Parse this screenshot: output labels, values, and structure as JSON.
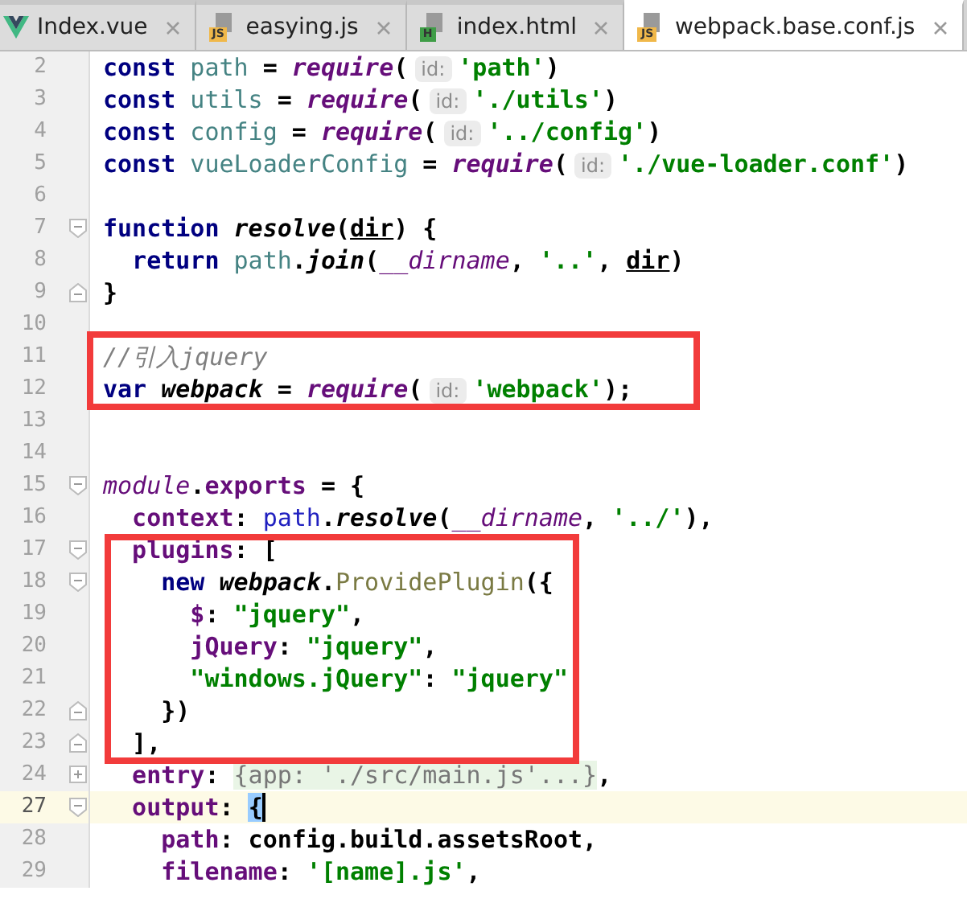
{
  "tabs": [
    {
      "label": "Index.vue",
      "kind": "vue",
      "selected": false
    },
    {
      "label": "easying.js",
      "kind": "js",
      "icon_label": "JS",
      "selected": false
    },
    {
      "label": "index.html",
      "kind": "html",
      "icon_label": "H",
      "selected": false
    },
    {
      "label": "webpack.base.conf.js",
      "kind": "js",
      "icon_label": "JS",
      "selected": true
    }
  ],
  "lines": [
    {
      "number": "2",
      "tokens": [
        {
          "kind": "kw",
          "text": "const"
        },
        {
          "kind": "var",
          "text": " path"
        },
        {
          "kind": "plain",
          "text": " = "
        },
        {
          "kind": "call",
          "text": "require"
        },
        {
          "kind": "plain",
          "text": "("
        },
        {
          "kind": "hint",
          "text": "id:"
        },
        {
          "kind": "str",
          "text": "'path'"
        },
        {
          "kind": "plain",
          "text": ")"
        }
      ]
    },
    {
      "number": "3",
      "tokens": [
        {
          "kind": "kw",
          "text": "const"
        },
        {
          "kind": "var",
          "text": " utils"
        },
        {
          "kind": "plain",
          "text": " = "
        },
        {
          "kind": "call",
          "text": "require"
        },
        {
          "kind": "plain",
          "text": "("
        },
        {
          "kind": "hint",
          "text": "id:"
        },
        {
          "kind": "str",
          "text": "'./utils'"
        },
        {
          "kind": "plain",
          "text": ")"
        }
      ]
    },
    {
      "number": "4",
      "tokens": [
        {
          "kind": "kw",
          "text": "const"
        },
        {
          "kind": "var",
          "text": " config"
        },
        {
          "kind": "plain",
          "text": " = "
        },
        {
          "kind": "call",
          "text": "require"
        },
        {
          "kind": "plain",
          "text": "("
        },
        {
          "kind": "hint",
          "text": "id:"
        },
        {
          "kind": "str",
          "text": "'../config'"
        },
        {
          "kind": "plain",
          "text": ")"
        }
      ]
    },
    {
      "number": "5",
      "tokens": [
        {
          "kind": "kw",
          "text": "const"
        },
        {
          "kind": "var",
          "text": " vueLoaderConfig"
        },
        {
          "kind": "plain",
          "text": " = "
        },
        {
          "kind": "call",
          "text": "require"
        },
        {
          "kind": "plain",
          "text": "("
        },
        {
          "kind": "hint",
          "text": "id:"
        },
        {
          "kind": "str",
          "text": "'./vue-loader.conf'"
        },
        {
          "kind": "plain",
          "text": ")"
        }
      ]
    },
    {
      "number": "6"
    },
    {
      "number": "7",
      "fold": {
        "kind": "open"
      },
      "tokens": [
        {
          "kind": "kw",
          "text": "function"
        },
        {
          "kind": "italic",
          "text": " resolve"
        },
        {
          "kind": "plain",
          "text": "("
        },
        {
          "kind": "param",
          "text": "dir"
        },
        {
          "kind": "plain",
          "text": ") {"
        }
      ]
    },
    {
      "number": "8",
      "tokens": [
        {
          "kind": "kw",
          "text": "  return"
        },
        {
          "kind": "var",
          "text": " path"
        },
        {
          "kind": "plain",
          "text": "."
        },
        {
          "kind": "italic",
          "text": "join"
        },
        {
          "kind": "plain",
          "text": "("
        },
        {
          "kind": "global",
          "text": "__dirname"
        },
        {
          "kind": "plain",
          "text": ", "
        },
        {
          "kind": "str",
          "text": "'..'"
        },
        {
          "kind": "plain",
          "text": ", "
        },
        {
          "kind": "param",
          "text": "dir"
        },
        {
          "kind": "plain",
          "text": ")"
        }
      ]
    },
    {
      "number": "9",
      "fold": {
        "kind": "close"
      },
      "tokens": [
        {
          "kind": "plain",
          "text": "}"
        }
      ]
    },
    {
      "number": "10"
    },
    {
      "number": "11",
      "boxed": true,
      "tokens": [
        {
          "kind": "comment",
          "text": "//引入jquery"
        }
      ]
    },
    {
      "number": "12",
      "boxed": true,
      "tokens": [
        {
          "kind": "kw",
          "text": "var"
        },
        {
          "kind": "italic",
          "text": " webpack"
        },
        {
          "kind": "plain",
          "text": " = "
        },
        {
          "kind": "call",
          "text": "require"
        },
        {
          "kind": "plain",
          "text": "("
        },
        {
          "kind": "hint",
          "text": "id:"
        },
        {
          "kind": "str",
          "text": "'webpack'"
        },
        {
          "kind": "plain",
          "text": ");"
        }
      ]
    },
    {
      "number": "13"
    },
    {
      "number": "14"
    },
    {
      "number": "15",
      "fold": {
        "kind": "open"
      },
      "tokens": [
        {
          "kind": "global",
          "text": "module"
        },
        {
          "kind": "plain",
          "text": "."
        },
        {
          "kind": "prop",
          "text": "exports"
        },
        {
          "kind": "plain",
          "text": " = {"
        }
      ]
    },
    {
      "number": "16",
      "tokens": [
        {
          "kind": "prop",
          "text": "  context"
        },
        {
          "kind": "plain",
          "text": ": "
        },
        {
          "kind": "ref",
          "text": "path"
        },
        {
          "kind": "plain",
          "text": "."
        },
        {
          "kind": "italic",
          "text": "resolve"
        },
        {
          "kind": "plain",
          "text": "("
        },
        {
          "kind": "global",
          "text": "__dirname"
        },
        {
          "kind": "plain",
          "text": ", "
        },
        {
          "kind": "str",
          "text": "'../'"
        },
        {
          "kind": "plain",
          "text": "),"
        }
      ]
    },
    {
      "number": "17",
      "fold": {
        "kind": "open"
      },
      "boxed": true,
      "tokens": [
        {
          "kind": "prop",
          "text": "  plugins"
        },
        {
          "kind": "plain",
          "text": ": ["
        }
      ]
    },
    {
      "number": "18",
      "fold": {
        "kind": "open"
      },
      "boxed": true,
      "tokens": [
        {
          "kind": "kw",
          "text": "    new"
        },
        {
          "kind": "italic",
          "text": " webpack"
        },
        {
          "kind": "plain",
          "text": "."
        },
        {
          "kind": "method",
          "text": "ProvidePlugin"
        },
        {
          "kind": "plain",
          "text": "({"
        }
      ]
    },
    {
      "number": "19",
      "boxed": true,
      "tokens": [
        {
          "kind": "prop",
          "text": "      $"
        },
        {
          "kind": "plain",
          "text": ": "
        },
        {
          "kind": "str",
          "text": "\"jquery\""
        },
        {
          "kind": "plain",
          "text": ","
        }
      ]
    },
    {
      "number": "20",
      "boxed": true,
      "tokens": [
        {
          "kind": "prop",
          "text": "      jQuery"
        },
        {
          "kind": "plain",
          "text": ": "
        },
        {
          "kind": "str",
          "text": "\"jquery\""
        },
        {
          "kind": "plain",
          "text": ","
        }
      ]
    },
    {
      "number": "21",
      "boxed": true,
      "tokens": [
        {
          "kind": "str",
          "text": "      \"windows.jQuery\""
        },
        {
          "kind": "plain",
          "text": ": "
        },
        {
          "kind": "str",
          "text": "\"jquery\""
        }
      ]
    },
    {
      "number": "22",
      "fold": {
        "kind": "close"
      },
      "boxed": true,
      "tokens": [
        {
          "kind": "plain",
          "text": "    })"
        }
      ]
    },
    {
      "number": "23",
      "fold": {
        "kind": "close"
      },
      "boxed": true,
      "tokens": [
        {
          "kind": "plain",
          "text": "  ],"
        }
      ]
    },
    {
      "number": "24",
      "fold": {
        "kind": "plus"
      },
      "tokens": [
        {
          "kind": "prop",
          "text": "  entry"
        },
        {
          "kind": "plain",
          "text": ": "
        },
        {
          "kind": "folded",
          "text": "{app: './src/main.js'...}"
        },
        {
          "kind": "plain",
          "text": ","
        }
      ]
    },
    {
      "number": "27",
      "fold": {
        "kind": "open"
      },
      "current": true,
      "tokens": [
        {
          "kind": "prop",
          "text": "  output"
        },
        {
          "kind": "plain",
          "text": ": "
        },
        {
          "kind": "brace",
          "text": "{"
        }
      ]
    },
    {
      "number": "28",
      "tokens": [
        {
          "kind": "prop",
          "text": "    path"
        },
        {
          "kind": "plain",
          "text": ": config.build.assetsRoot,"
        }
      ]
    },
    {
      "number": "29",
      "tokens": [
        {
          "kind": "prop",
          "text": "    filename"
        },
        {
          "kind": "plain",
          "text": ": "
        },
        {
          "kind": "str",
          "text": "'[name].js'"
        },
        {
          "kind": "plain",
          "text": ","
        }
      ]
    }
  ]
}
